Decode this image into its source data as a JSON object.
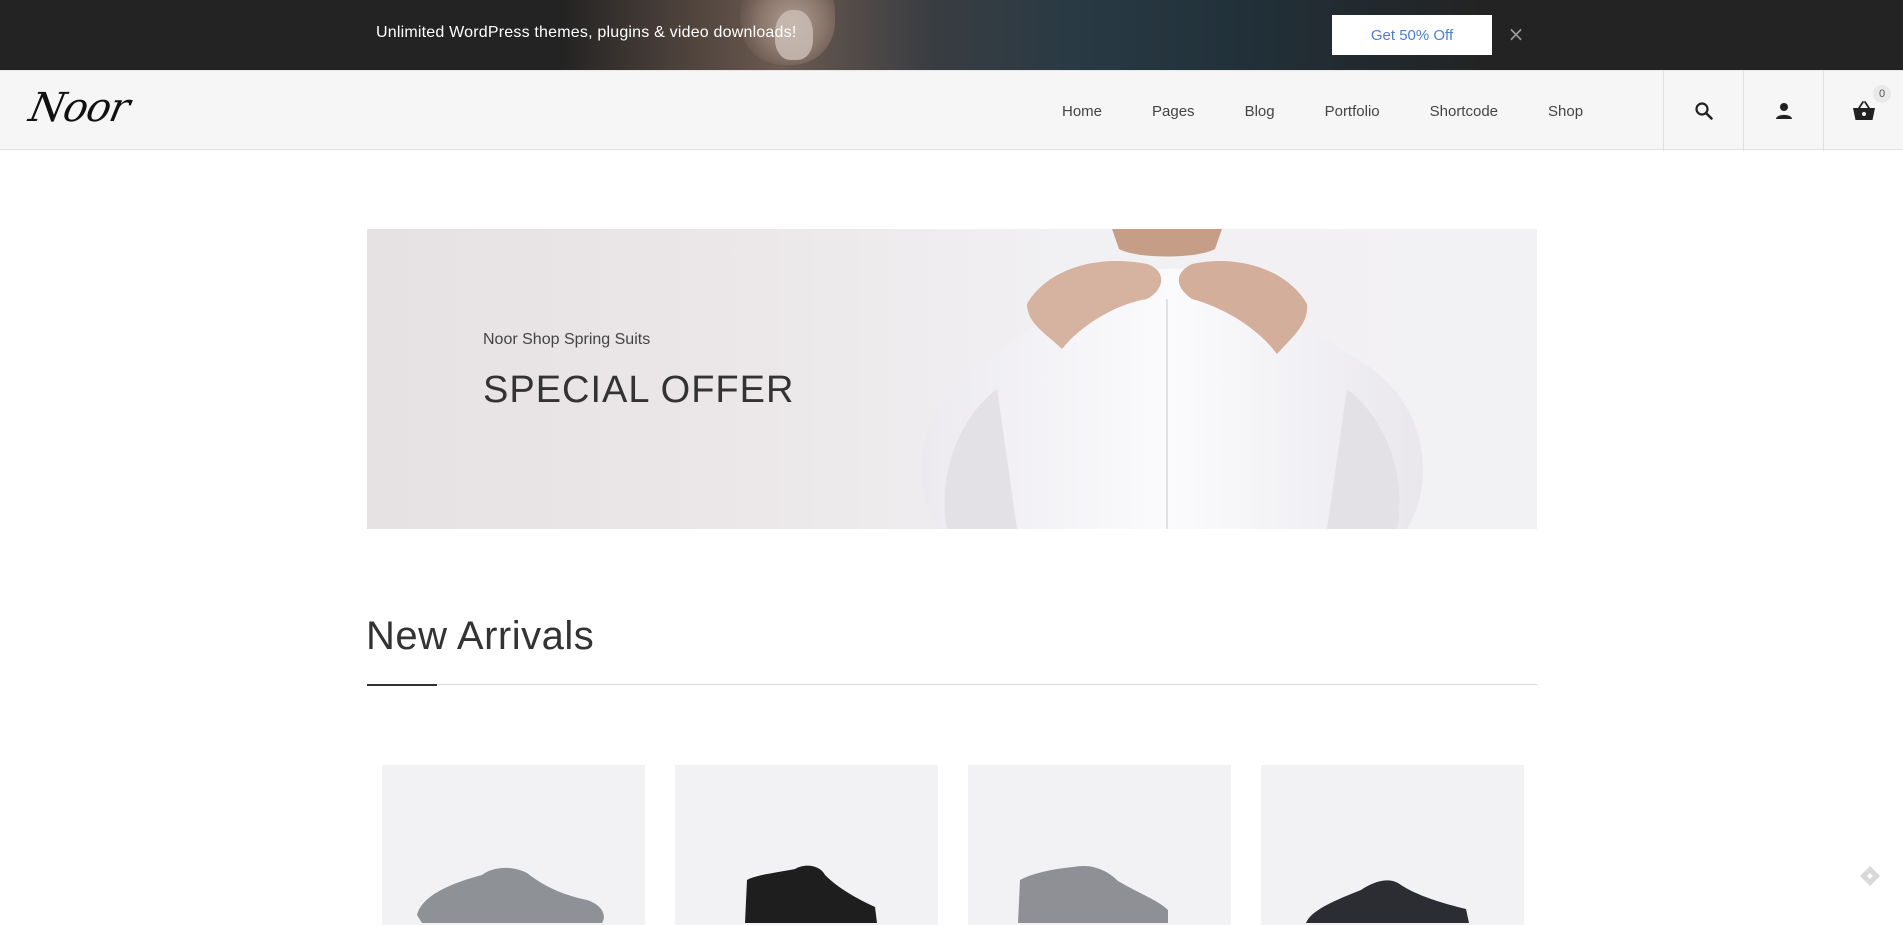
{
  "promo": {
    "text": "Unlimited WordPress themes, plugins & video downloads!",
    "button_label": "Get 50% Off",
    "close_icon": "×"
  },
  "header": {
    "logo_text": "Noor",
    "nav": [
      "Home",
      "Pages",
      "Blog",
      "Portfolio",
      "Shortcode",
      "Shop"
    ],
    "icons": [
      "search-icon",
      "user-icon",
      "basket-icon"
    ],
    "cart_count": "0"
  },
  "hero": {
    "subtitle": "Noor Shop Spring Suits",
    "title": "SPECIAL OFFER"
  },
  "new_arrivals": {
    "title": "New Arrivals",
    "products": [
      {
        "shoe_color": "#8e9196"
      },
      {
        "shoe_color": "#1e1e1e"
      },
      {
        "shoe_color": "#8f9095"
      },
      {
        "shoe_color": "#2b2d33"
      }
    ]
  },
  "colors": {
    "promo_bg": "#232323",
    "button_text": "#4a7fd1",
    "header_bg": "#f6f6f6",
    "hero_bg": "#ebe7e9",
    "product_bg": "#f2f2f4"
  }
}
